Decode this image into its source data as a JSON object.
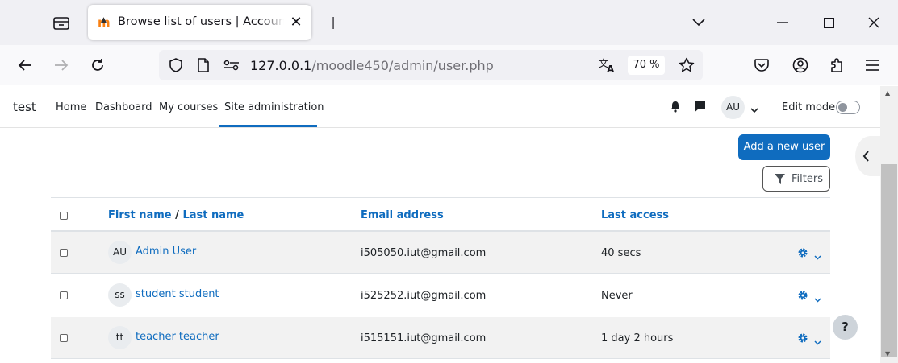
{
  "browser": {
    "tab_title": "Browse list of users | Accounts | test",
    "tab_favicon": "m",
    "url_host": "127.0.0.1",
    "url_path": "/moodle450/admin/user.php",
    "zoom": "70 %",
    "icons": [
      "tab-list-icon",
      "close-icon",
      "plus-icon",
      "chevron-down-icon",
      "minimize-icon",
      "maximize-icon",
      "window-close-icon",
      "back-icon",
      "forward-icon",
      "reload-icon",
      "shield-icon",
      "page-icon",
      "permissions-icon",
      "translate-icon",
      "star-icon",
      "pocket-icon",
      "account-icon",
      "extensions-icon",
      "menu-icon"
    ]
  },
  "moodle": {
    "site_name": "test",
    "nav": [
      "Home",
      "Dashboard",
      "My courses",
      "Site administration"
    ],
    "active_nav": "Site administration",
    "user_initials": "AU",
    "edit_mode_label": "Edit mode",
    "edit_mode_on": false,
    "add_user_label": "Add a new user",
    "filters_label": "Filters",
    "help_label": "?",
    "accent_color": "#0f6cbf"
  },
  "table": {
    "headers": {
      "first_name": "First name",
      "separator": " / ",
      "last_name": "Last name",
      "email": "Email address",
      "last_access": "Last access"
    },
    "rows": [
      {
        "initials": "AU",
        "name": "Admin User",
        "email": "i505050.iut@gmail.com",
        "last_access": "40 secs"
      },
      {
        "initials": "ss",
        "name": "student student",
        "email": "i525252.iut@gmail.com",
        "last_access": "Never"
      },
      {
        "initials": "tt",
        "name": "teacher teacher",
        "email": "i515151.iut@gmail.com",
        "last_access": "1 day 2 hours"
      }
    ]
  }
}
